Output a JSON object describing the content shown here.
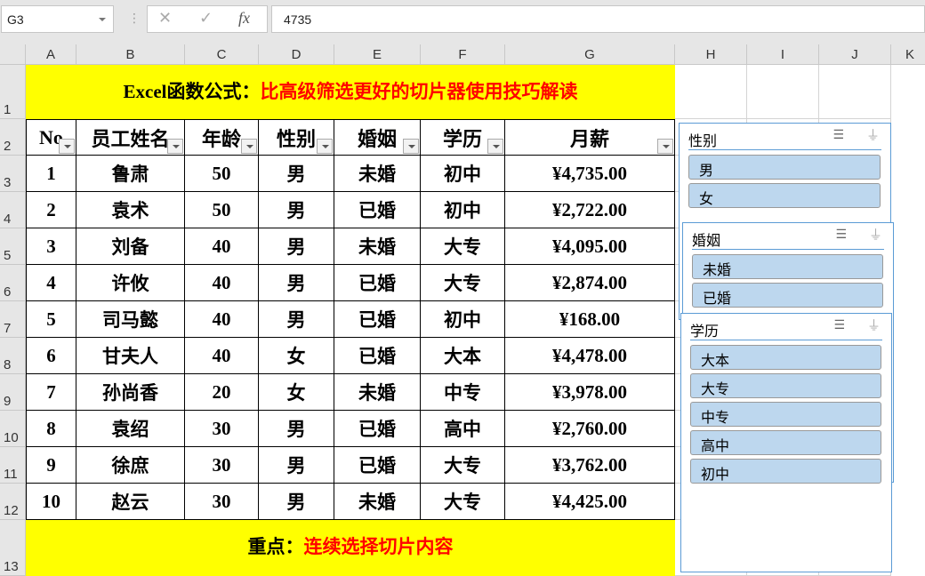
{
  "formula_bar": {
    "name_box": "G3",
    "cancel_icon": "✕",
    "enter_icon": "✓",
    "fx_label": "fx",
    "value": "4735"
  },
  "columns": [
    "A",
    "B",
    "C",
    "D",
    "E",
    "F",
    "G",
    "H",
    "I",
    "J",
    "K"
  ],
  "rows": [
    "1",
    "2",
    "3",
    "4",
    "5",
    "6",
    "7",
    "8",
    "9",
    "10",
    "11",
    "12",
    "13"
  ],
  "title": {
    "black": "Excel函数公式：",
    "red": "比高级筛选更好的切片器使用技巧解读"
  },
  "table": {
    "headers": [
      "No",
      "员工姓名",
      "年龄",
      "性别",
      "婚姻",
      "学历",
      "月薪"
    ],
    "rows": [
      [
        "1",
        "鲁肃",
        "50",
        "男",
        "未婚",
        "初中",
        "¥4,735.00"
      ],
      [
        "2",
        "袁术",
        "50",
        "男",
        "已婚",
        "初中",
        "¥2,722.00"
      ],
      [
        "3",
        "刘备",
        "40",
        "男",
        "未婚",
        "大专",
        "¥4,095.00"
      ],
      [
        "4",
        "许攸",
        "40",
        "男",
        "已婚",
        "大专",
        "¥2,874.00"
      ],
      [
        "5",
        "司马懿",
        "40",
        "男",
        "已婚",
        "初中",
        "¥168.00"
      ],
      [
        "6",
        "甘夫人",
        "40",
        "女",
        "已婚",
        "大本",
        "¥4,478.00"
      ],
      [
        "7",
        "孙尚香",
        "20",
        "女",
        "未婚",
        "中专",
        "¥3,978.00"
      ],
      [
        "8",
        "袁绍",
        "30",
        "男",
        "已婚",
        "高中",
        "¥2,760.00"
      ],
      [
        "9",
        "徐庶",
        "30",
        "男",
        "已婚",
        "大专",
        "¥3,762.00"
      ],
      [
        "10",
        "赵云",
        "30",
        "男",
        "未婚",
        "大专",
        "¥4,425.00"
      ]
    ]
  },
  "footer": {
    "black": "重点：",
    "red": "连续选择切片内容"
  },
  "slicers": [
    {
      "title": "性别",
      "items": [
        "男",
        "女"
      ]
    },
    {
      "title": "婚姻",
      "items": [
        "未婚",
        "已婚"
      ]
    },
    {
      "title": "学历",
      "items": [
        "大本",
        "大专",
        "中专",
        "高中",
        "初中"
      ]
    }
  ],
  "colors": {
    "yellow": "#ffff00",
    "red": "#ff0000",
    "slicer_item": "#bdd7ee",
    "slicer_border": "#5b9bd5"
  }
}
